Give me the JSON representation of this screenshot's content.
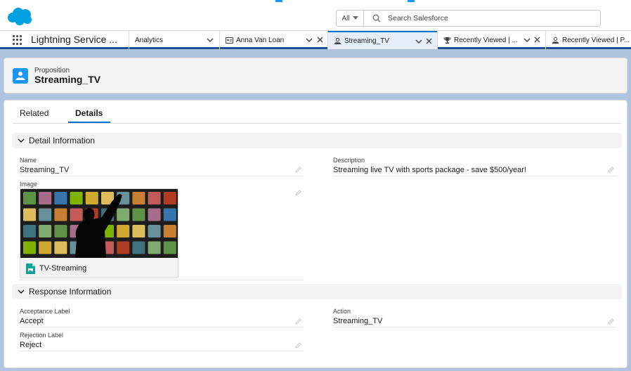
{
  "header": {
    "search_scope": "All",
    "search_placeholder": "Search Salesforce"
  },
  "nav": {
    "app_name": "Lightning Service ...",
    "tabs": [
      {
        "label": "Analytics"
      },
      {
        "label": "Anna Van Loan"
      },
      {
        "label": "Streaming_TV"
      },
      {
        "label": "Recently Viewed | ..."
      },
      {
        "label": "Recently Viewed | P..."
      }
    ]
  },
  "record": {
    "type": "Proposition",
    "name": "Streaming_TV"
  },
  "tabs": {
    "related": "Related",
    "details": "Details"
  },
  "detail_section": {
    "title": "Detail Information",
    "name_label": "Name",
    "name_value": "Streaming_TV",
    "description_label": "Description",
    "description_value": "Streaming live TV with sports package - save $500/year!",
    "image_label": "Image",
    "image_file": "TV-Streaming"
  },
  "response_section": {
    "title": "Response Information",
    "acceptance_label": "Acceptance Label",
    "acceptance_value": "Accept",
    "action_label": "Action",
    "action_value": "Streaming_TV",
    "rejection_label": "Rejection Label",
    "rejection_value": "Reject"
  },
  "colors": {
    "brand": "#0176d3",
    "logo": "#00a1e0",
    "nav_border": "#1b5297",
    "background": "#b0c4df"
  }
}
